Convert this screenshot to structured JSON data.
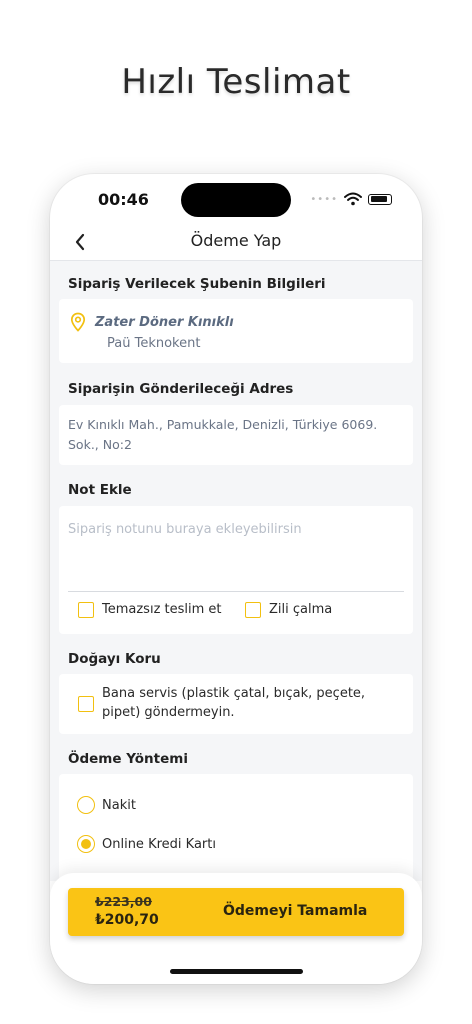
{
  "headline": "Hızlı Teslimat",
  "status": {
    "time": "00:46"
  },
  "nav": {
    "title": "Ödeme Yap"
  },
  "branch": {
    "section_title": "Sipariş Verilecek Şubenin Bilgileri",
    "name": "Zater Döner Kınıklı",
    "location": "Paü Teknokent"
  },
  "address": {
    "section_title": "Siparişin Gönderileceği Adres",
    "text": "Ev Kınıklı Mah., Pamukkale, Denizli, Türkiye 6069. Sok., No:2"
  },
  "note": {
    "section_title": "Not Ekle",
    "placeholder": "Sipariş notunu buraya ekleyebilirsin",
    "options": [
      {
        "label": "Temazsız teslim et",
        "checked": false
      },
      {
        "label": "Zili çalma",
        "checked": false
      }
    ]
  },
  "nature": {
    "section_title": "Doğayı Koru",
    "option_label": "Bana servis (plastik çatal, bıçak, peçete, pipet) göndermeyin.",
    "checked": false
  },
  "payment": {
    "section_title": "Ödeme Yöntemi",
    "methods": [
      {
        "label": "Nakit",
        "selected": false
      },
      {
        "label": "Online Kredi Kartı",
        "selected": true
      }
    ]
  },
  "checkout": {
    "old_price": "₺223,00",
    "new_price": "₺200,70",
    "button_label": "Ödemeyi Tamamla"
  },
  "colors": {
    "accent": "#fac415",
    "background": "#f5f6f8"
  }
}
